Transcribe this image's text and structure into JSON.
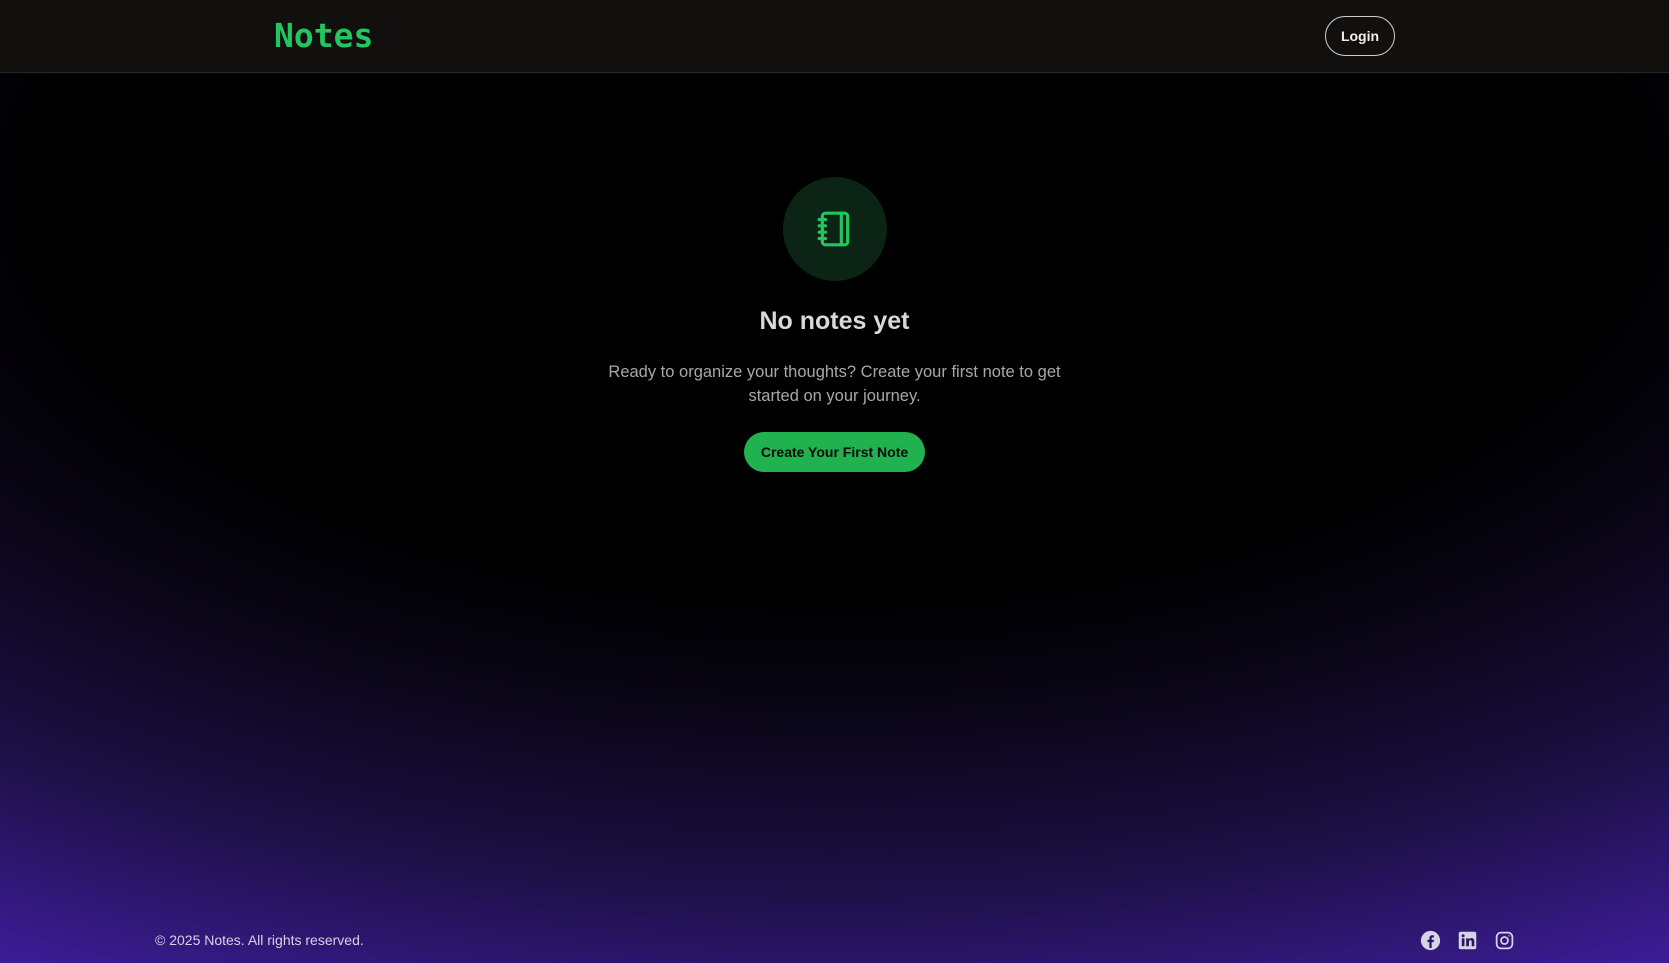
{
  "header": {
    "logo": "Notes",
    "login_label": "Login"
  },
  "empty_state": {
    "icon": "notebook-icon",
    "title": "No notes yet",
    "description": "Ready to organize your thoughts? Create your first note to get started on your journey.",
    "cta_label": "Create Your First Note"
  },
  "footer": {
    "copyright": "© 2025 Notes. All rights reserved.",
    "socials": [
      "facebook-icon",
      "linkedin-icon",
      "instagram-icon"
    ]
  },
  "colors": {
    "accent": "#22c55e",
    "button": "#1fb24f",
    "header_bg": "#120f0f",
    "gradient_bottom": "#4a22b8"
  }
}
